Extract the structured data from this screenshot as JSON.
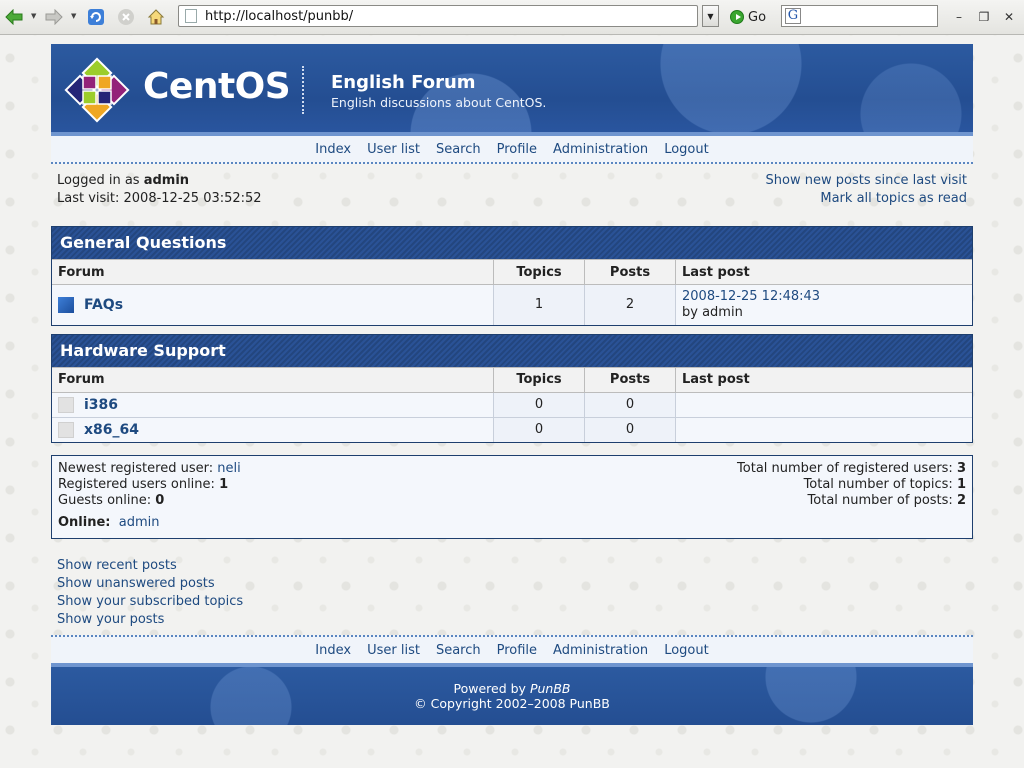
{
  "browser": {
    "url": "http://localhost/punbb/",
    "go_label": "Go",
    "search_placeholder": "",
    "window_controls": [
      "–",
      "❐",
      "✕"
    ]
  },
  "header": {
    "logo_text": "CentOS",
    "board_title": "English Forum",
    "board_desc": "English discussions about CentOS."
  },
  "nav": {
    "items": [
      "Index",
      "User list",
      "Search",
      "Profile",
      "Administration",
      "Logout"
    ]
  },
  "userinfo": {
    "logged_prefix": "Logged in as",
    "username": "admin",
    "last_visit": "Last visit: 2008-12-25 03:52:52",
    "show_new": "Show new posts since last visit",
    "mark_read": "Mark all topics as read"
  },
  "categories": [
    {
      "title": "General Questions",
      "headers": [
        "Forum",
        "Topics",
        "Posts",
        "Last post"
      ],
      "forums": [
        {
          "name": "FAQs",
          "topics": "1",
          "posts": "2",
          "last_post": "2008-12-25 12:48:43",
          "last_by": "by admin",
          "icon": "new-posts-icon"
        }
      ]
    },
    {
      "title": "Hardware Support",
      "headers": [
        "Forum",
        "Topics",
        "Posts",
        "Last post"
      ],
      "forums": [
        {
          "name": "i386",
          "topics": "0",
          "posts": "0",
          "last_post": "",
          "last_by": "",
          "icon": "no-new-posts-icon"
        },
        {
          "name": "x86_64",
          "topics": "0",
          "posts": "0",
          "last_post": "",
          "last_by": "",
          "icon": "no-new-posts-icon"
        }
      ]
    }
  ],
  "stats": {
    "newest_label": "Newest registered user:",
    "newest_user": "neli",
    "reg_online_label": "Registered users online:",
    "reg_online": "1",
    "guests_label": "Guests online:",
    "guests": "0",
    "total_users_label": "Total number of registered users:",
    "total_users": "3",
    "total_topics_label": "Total number of topics:",
    "total_topics": "1",
    "total_posts_label": "Total number of posts:",
    "total_posts": "2",
    "online_label": "Online:",
    "online_user": "admin"
  },
  "quick_links": [
    "Show recent posts",
    "Show unanswered posts",
    "Show your subscribed topics",
    "Show your posts"
  ],
  "footer": {
    "powered_prefix": "Powered by",
    "powered_name": "PunBB",
    "copyright": "© Copyright 2002–2008 PunBB"
  },
  "colors": {
    "accent": "#2c5aa0",
    "link": "#1e4a80",
    "header_bar": "#23467f"
  }
}
